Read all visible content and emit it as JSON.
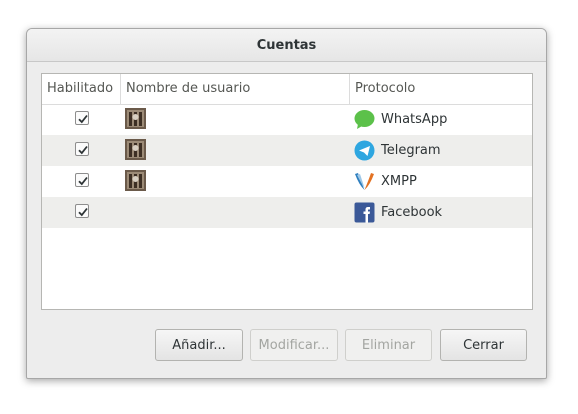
{
  "dialog": {
    "title": "Cuentas",
    "columns": {
      "enabled": "Habilitado",
      "username": "Nombre de usuario",
      "protocol": "Protocolo"
    },
    "accounts": [
      {
        "enabled": true,
        "has_avatar": true,
        "protocol": "WhatsApp",
        "icon": "whatsapp-icon"
      },
      {
        "enabled": true,
        "has_avatar": true,
        "protocol": "Telegram",
        "icon": "telegram-icon"
      },
      {
        "enabled": true,
        "has_avatar": true,
        "protocol": "XMPP",
        "icon": "xmpp-icon"
      },
      {
        "enabled": true,
        "has_avatar": false,
        "protocol": "Facebook",
        "icon": "facebook-icon"
      }
    ],
    "buttons": {
      "add": "Añadir...",
      "modify": "Modificar...",
      "delete": "Eliminar",
      "close": "Cerrar"
    }
  },
  "colors": {
    "whatsapp": "#5cc14a",
    "telegram": "#2ea6e0",
    "facebook": "#3b5998",
    "disabled_text": "#a3a5a1"
  }
}
